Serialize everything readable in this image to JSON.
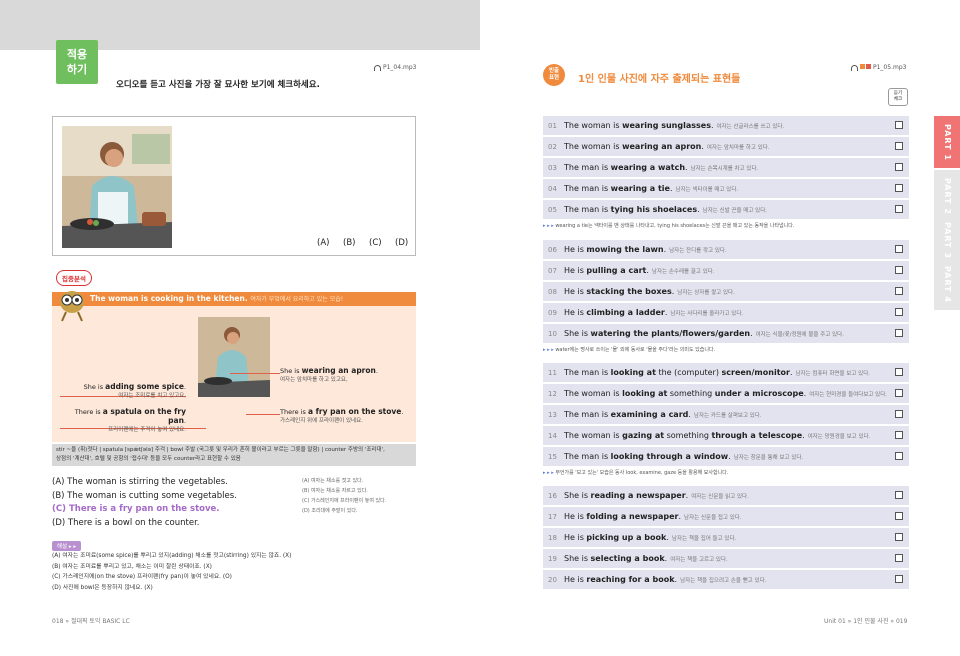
{
  "left": {
    "badge": "적용\n하기",
    "instruction": "오디오를 듣고 사진을 가장 잘 묘사한 보기에 체크하세요.",
    "audio": "P1_04.mp3",
    "options": [
      "(A)",
      "(B)",
      "(C)",
      "(D)"
    ],
    "focus_tag": "집중분석",
    "focus_title": "The woman is cooking in the kitchen.",
    "focus_title_kr": "여자가 부엌에서 요리하고 있는 모습!",
    "annotations": [
      {
        "pre": "She is ",
        "bold": "adding some spice",
        "post": ".",
        "kr": "여자는 조미료를 치고 있고요,"
      },
      {
        "pre": "There is ",
        "bold": "a spatula on the fry pan",
        "post": ".",
        "kr": "프라이팬에는 주걱이 놓여 있네요."
      },
      {
        "pre": "She is ",
        "bold": "wearing an apron",
        "post": ".",
        "kr": "여자는 앞치마를 하고 있고요,"
      },
      {
        "pre": "There is ",
        "bold": "a fry pan on the stove",
        "post": ".",
        "kr": "가스레인지 위에 프라이팬이 있네요."
      }
    ],
    "vocab1": "stir ~을 (휘)젓다 | spatula [spǽtʃələ] 주걱 | bowl 주발 (국그릇 및 우리가 흔히 볼이라고 부르는 그릇을 말함) | counter 주방의 '조리대',",
    "vocab2": "상점의 '계산대', 호텔 및 공항의 '접수대' 등을 모두 counter라고 표현할 수 있음",
    "choices": [
      "(A) The woman is stirring the vegetables.",
      "(B) The woman is cutting some vegetables.",
      "(C) There is a fry pan on the stove.",
      "(D) There is a bowl on the counter."
    ],
    "choices_kr": [
      "(A) 여자는 채소를 젓고 있다.",
      "(B) 여자는 채소를 자르고 있다.",
      "(C) 가스레인지에 프라이팬이 놓여 있다.",
      "(D) 조리대에 주발이 있다."
    ],
    "explain_tag": "해설",
    "explain": [
      "(A) 여자는 조미료(some spice)를 뿌리고 있지(adding) 채소를 젓고(stirring) 있지는 않죠. (X)",
      "(B) 여자는 조미료를 뿌리고 있고, 채소는 이미 잘린 상태이죠. (X)",
      "(C) 가스레인지에(on the stove) 프라이팬(fry pan)이 놓여 있네요. (O)",
      "(D) 사진에 bowl은 등장하지 않네요. (X)"
    ],
    "footer": "018 » 절대픽 토익 BASIC LC"
  },
  "right": {
    "pill": "빈출\n표현",
    "title": "1인 인물 사진에 자주 출제되는 표현들",
    "audio": "P1_05.mp3",
    "listen": "듣기\n체크",
    "groups": [
      {
        "rows": [
          {
            "n": "01",
            "pre": "The woman is ",
            "bold": "wearing sunglasses",
            "post": ".",
            "kr": "여자는 선글라스를 쓰고 있다."
          },
          {
            "n": "02",
            "pre": "The woman is ",
            "bold": "wearing an apron",
            "post": ".",
            "kr": "여자는 앞치마를 하고 있다."
          },
          {
            "n": "03",
            "pre": "The man is ",
            "bold": "wearing a watch",
            "post": ".",
            "kr": "남자는 손목시계를 차고 있다."
          },
          {
            "n": "04",
            "pre": "The man is ",
            "bold": "wearing a tie",
            "post": ".",
            "kr": "남자는 넥타이를 매고 있다."
          },
          {
            "n": "05",
            "pre": "The man is ",
            "bold": "tying his shoelaces",
            "post": ".",
            "kr": "남자는 신발 끈을 매고 있다."
          }
        ],
        "note": "wearing a tie는 넥타이를 맨 상태를 나타내고, tying his shoelaces는 신발 끈을 매고 있는 동작을 나타냅니다."
      },
      {
        "rows": [
          {
            "n": "06",
            "pre": "He is ",
            "bold": "mowing the lawn",
            "post": ".",
            "kr": "남자는 잔디를 깎고 있다."
          },
          {
            "n": "07",
            "pre": "He is ",
            "bold": "pulling a cart",
            "post": ".",
            "kr": "남자는 손수레를 끌고 있다."
          },
          {
            "n": "08",
            "pre": "He is ",
            "bold": "stacking the boxes",
            "post": ".",
            "kr": "남자는 상자를 쌓고 있다."
          },
          {
            "n": "09",
            "pre": "He is ",
            "bold": "climbing a ladder",
            "post": ".",
            "kr": "남자는 사다리를 올라가고 있다."
          },
          {
            "n": "10",
            "pre": "She is ",
            "bold": "watering the plants/flowers/garden",
            "post": ".",
            "kr": "여자는 식물/꽃/정원에 물을 주고 있다."
          }
        ],
        "note": "water에는 명사로 쓰이는 '물' 외에 동사로 '물을 주다'라는 의미도 있습니다."
      },
      {
        "rows": [
          {
            "n": "11",
            "pre": "The man is ",
            "bold": "looking at",
            "mid": " the (computer) ",
            "bold2": "screen/monitor",
            "post": ".",
            "kr": "남자는 컴퓨터 화면을 보고 있다."
          },
          {
            "n": "12",
            "pre": "The woman is ",
            "bold": "looking at",
            "mid": " something ",
            "bold2": "under a microscope",
            "post": ".",
            "kr": "여자는 현미경을 들여다보고 있다."
          },
          {
            "n": "13",
            "pre": "The man is ",
            "bold": "examining a card",
            "post": ".",
            "kr": "남자는 카드를 살펴보고 있다."
          },
          {
            "n": "14",
            "pre": "The woman is ",
            "bold": "gazing at",
            "mid": " something ",
            "bold2": "through a telescope",
            "post": ".",
            "kr": "여자는 망원경을 보고 있다."
          },
          {
            "n": "15",
            "pre": "The man is ",
            "bold": "looking through a window",
            "post": ".",
            "kr": "남자는 창문을 통해 보고 있다."
          }
        ],
        "note": "무언가를 '보고 있는' 모습은 동사 look, examine, gaze 등을 활용해 묘사합니다."
      },
      {
        "rows": [
          {
            "n": "16",
            "pre": "She is ",
            "bold": "reading a newspaper",
            "post": ".",
            "kr": "여자는 신문을 읽고 있다."
          },
          {
            "n": "17",
            "pre": "He is ",
            "bold": "folding a newspaper",
            "post": ".",
            "kr": "남자는 신문을 접고 있다."
          },
          {
            "n": "18",
            "pre": "He is ",
            "bold": "picking up a book",
            "post": ".",
            "kr": "남자는 책을 집어 들고 있다."
          },
          {
            "n": "19",
            "pre": "She is ",
            "bold": "selecting a book",
            "post": ".",
            "kr": "여자는 책을 고르고 있다."
          },
          {
            "n": "20",
            "pre": "He is ",
            "bold": "reaching for a book",
            "post": ".",
            "kr": "남자는 책을 집으려고 손을 뻗고 있다."
          }
        ],
        "note": ""
      }
    ],
    "tabs": [
      "PART 1",
      "PART 2",
      "PART 3",
      "PART 4"
    ],
    "footer": "Unit 01 » 1인 인물 사진 » 019"
  },
  "colors": {
    "green": "#6fbf5e",
    "orange": "#f08a3c",
    "peach": "#fde8da",
    "row": "#e2e3ef",
    "answer": "#a46bc9",
    "tab_active": "#f07474"
  }
}
